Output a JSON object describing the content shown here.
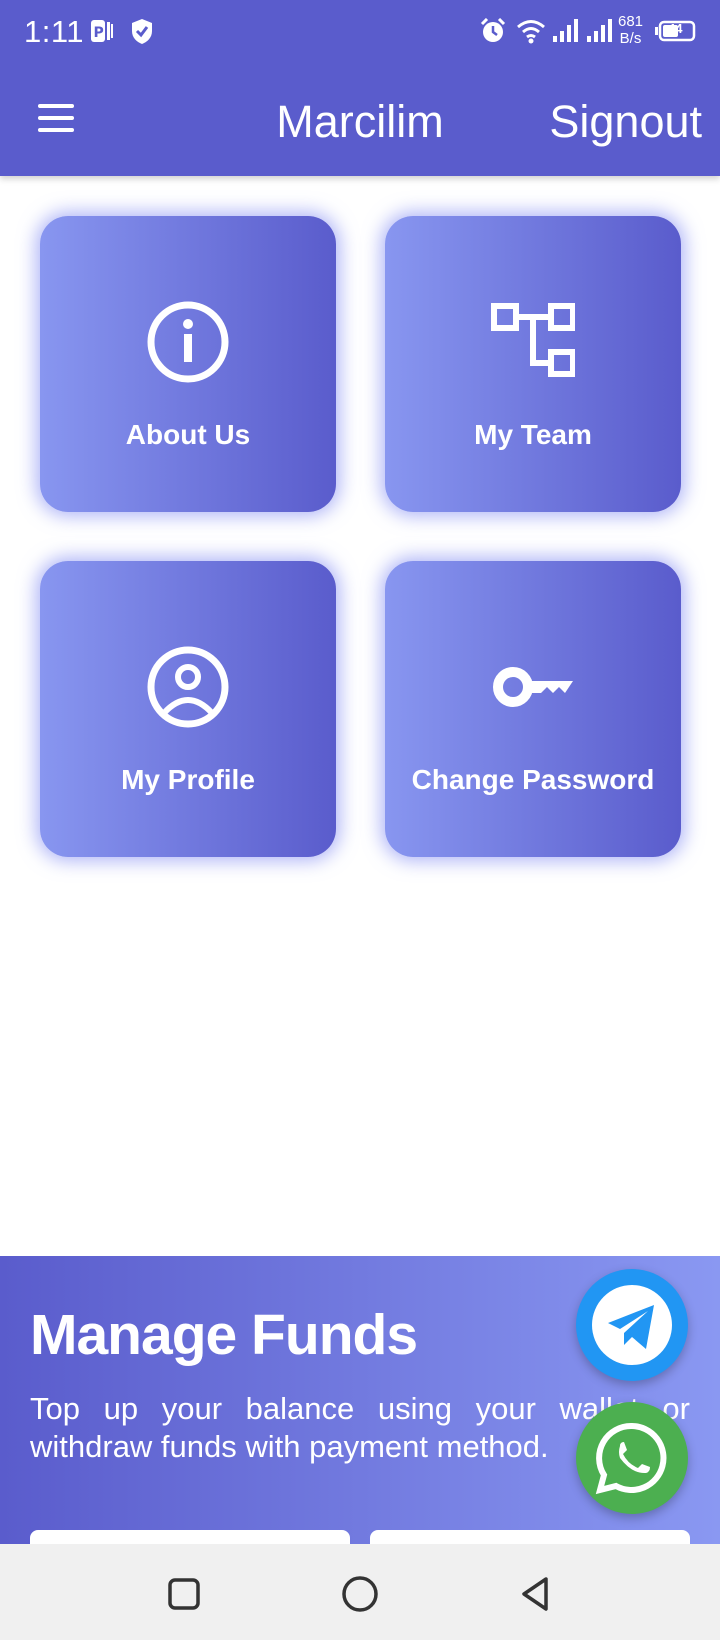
{
  "status_bar": {
    "time": "1:11",
    "net_speed_value": "681",
    "net_speed_unit": "B/s",
    "battery": "44"
  },
  "app_bar": {
    "title": "Marcilim",
    "signout_label": "Signout",
    "menu_icon": "hamburger-menu-icon"
  },
  "tiles": [
    {
      "label": "About Us",
      "icon": "info-icon"
    },
    {
      "label": "My Team",
      "icon": "hierarchy-icon"
    },
    {
      "label": "My Profile",
      "icon": "user-circle-icon"
    },
    {
      "label": "Change Password",
      "icon": "key-icon"
    }
  ],
  "funds": {
    "title": "Manage Funds",
    "description": "Top up your balance using your wallet or withdraw funds with payment method."
  },
  "fabs": {
    "telegram": {
      "icon": "telegram-icon",
      "color": "#2196f3"
    },
    "whatsapp": {
      "icon": "whatsapp-icon",
      "color": "#4caf50"
    }
  },
  "colors": {
    "primary": "#5a5ccc",
    "tile_gradient_start": "#8896f0",
    "tile_gradient_end": "#5a5ccc"
  }
}
